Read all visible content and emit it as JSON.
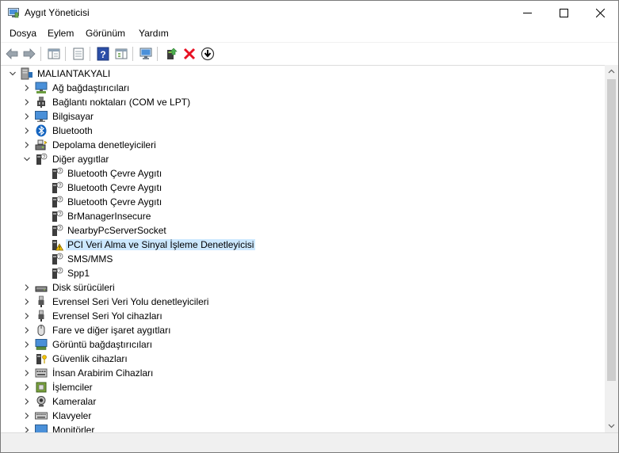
{
  "window": {
    "title": "Aygıt Yöneticisi",
    "controls": {
      "minimize": "minimize",
      "maximize": "maximize",
      "close": "close"
    }
  },
  "menu": [
    "Dosya",
    "Eylem",
    "Görünüm",
    "Yardım"
  ],
  "toolbar": {
    "buttons": [
      "back-arrow-icon",
      "forward-arrow-icon",
      "show-hide-console-tree-icon",
      "properties-icon",
      "help-icon",
      "action-pane-icon",
      "monitor-icon",
      "update-driver-icon",
      "uninstall-device-icon",
      "download-icon"
    ]
  },
  "tree": {
    "root": "MALIANTAKYALI",
    "categories": [
      "Ağ bağdaştırıcıları",
      "Bağlantı noktaları (COM ve LPT)",
      "Bilgisayar",
      "Bluetooth",
      "Depolama denetleyicileri",
      "Diğer aygıtlar"
    ],
    "other_devices": [
      "Bluetooth Çevre Aygıtı",
      "Bluetooth Çevre Aygıtı",
      "Bluetooth Çevre Aygıtı",
      "BrManagerInsecure",
      "NearbyPcServerSocket",
      "PCI Veri Alma ve Sinyal İşleme Denetleyicisi",
      "SMS/MMS",
      "Spp1"
    ],
    "more_categories": [
      "Disk sürücüleri",
      "Evrensel Seri Veri Yolu denetleyicileri",
      "Evrensel Seri Yol cihazları",
      "Fare ve diğer işaret aygıtları",
      "Görüntü bağdaştırıcıları",
      "Güvenlik cihazları",
      "İnsan Arabirim Cihazları",
      "İşlemciler",
      "Kameralar",
      "Klavyeler",
      "Monitörler"
    ],
    "selected": "PCI Veri Alma ve Sinyal İşleme Denetleyicisi"
  },
  "colors": {
    "selection": "#cce8ff",
    "error": "#e81123",
    "warning": "#f5c400"
  }
}
